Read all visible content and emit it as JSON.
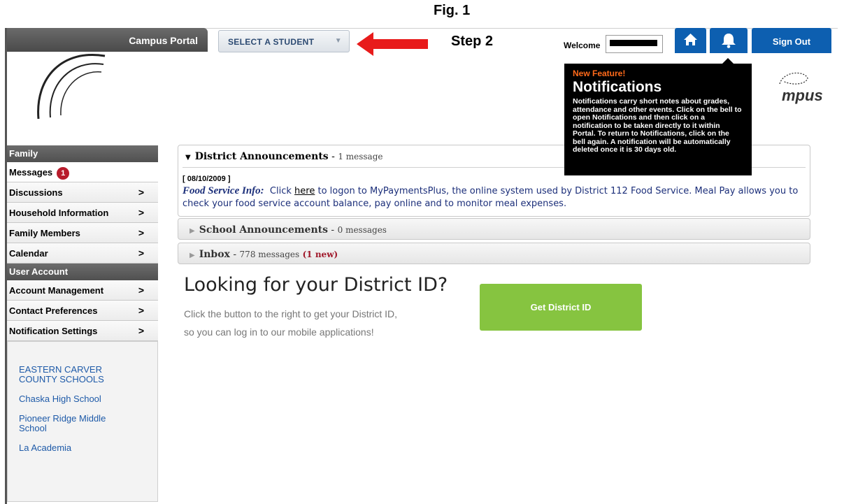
{
  "annotation": {
    "figure_label": "Fig. 1",
    "step_label": "Step 2",
    "arrow_color": "#e81b1b"
  },
  "header": {
    "portal_title": "Campus Portal",
    "student_select": {
      "label": "SELECT A STUDENT",
      "caret": "▼"
    },
    "welcome_label": "Welcome",
    "home_icon": "home-icon",
    "bell_icon": "bell-icon",
    "sign_out_label": "Sign Out",
    "logo_text": "mpus",
    "colors": {
      "accent": "#0d5fb0"
    }
  },
  "notification_popover": {
    "kicker": "New Feature!",
    "title": "Notifications",
    "body": "Notifications carry short notes about grades, attendance and other events. Click on the bell to open Notifications and then click on a notification to be taken directly to it within Portal. To return to Notifications, click on the bell again. A notification will be automatically deleted once it is 30 days old."
  },
  "sidebar": {
    "sections": [
      {
        "heading": "Family",
        "items": [
          {
            "label": "Messages",
            "badge": "1",
            "chevron": ""
          },
          {
            "label": "Discussions",
            "chevron": ">"
          },
          {
            "label": "Household Information",
            "chevron": ">"
          },
          {
            "label": "Family Members",
            "chevron": ">"
          },
          {
            "label": "Calendar",
            "chevron": ">"
          }
        ]
      },
      {
        "heading": "User Account",
        "items": [
          {
            "label": "Account Management",
            "chevron": ">"
          },
          {
            "label": "Contact Preferences",
            "chevron": ">"
          },
          {
            "label": "Notification Settings",
            "chevron": ">"
          }
        ]
      }
    ],
    "links": [
      "EASTERN CARVER COUNTY SCHOOLS",
      "Chaska High School",
      "Pioneer Ridge Middle School",
      "La Academia"
    ]
  },
  "announcements": {
    "district": {
      "title": "District Announcements",
      "count": "1 message",
      "toggle": "▼",
      "date": "[ 08/10/2009 ]",
      "heading": "Food Service Info:",
      "text_before_link": "Click",
      "link_text": "here",
      "text_after_link": "to logon to MyPaymentsPlus, the online system used by District 112 Food Service.  Meal Pay allows you to check your food service account balance, pay online and to monitor meal expenses."
    },
    "school": {
      "title": "School Announcements",
      "count": "0 messages",
      "toggle": "▶"
    },
    "inbox": {
      "title": "Inbox",
      "count": "778 messages",
      "new": "(1 new)",
      "toggle": "▶"
    }
  },
  "district_id": {
    "title": "Looking for your District ID?",
    "subtitle_line1": "Click the button to the right to get your District ID,",
    "subtitle_line2": "so you can log in to our mobile applications!",
    "button_label": "Get District ID",
    "button_color": "#86c440"
  }
}
